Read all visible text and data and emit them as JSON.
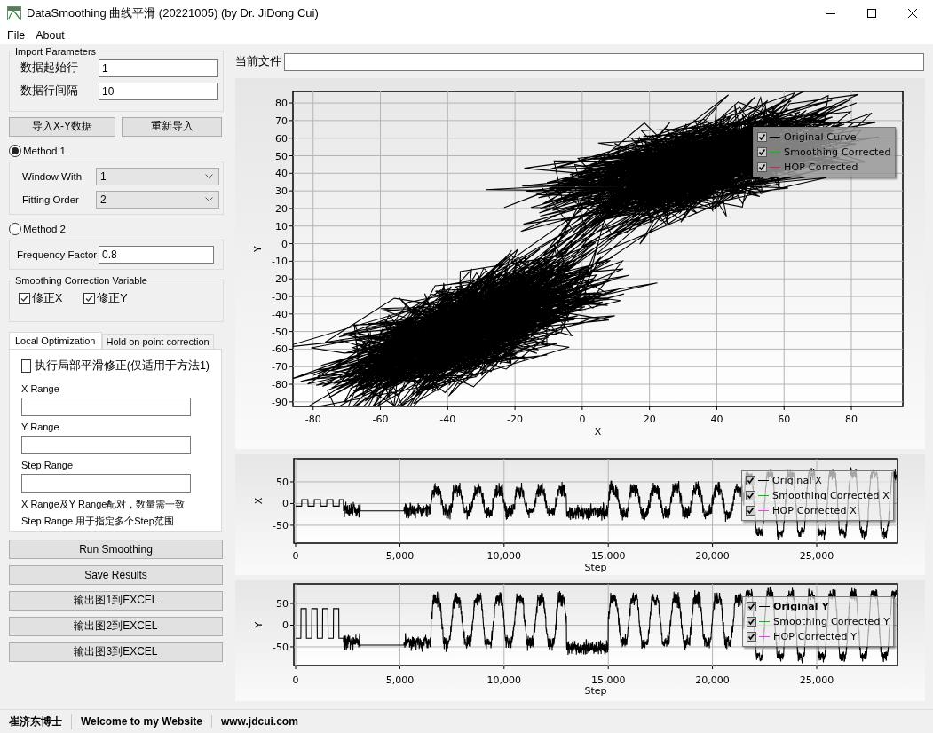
{
  "window": {
    "title": "DataSmoothing 曲线平滑 (20221005) (by Dr. JiDong Cui)"
  },
  "menu": [
    "File",
    "About"
  ],
  "import_parameters": {
    "title": "Import Parameters",
    "fields": [
      {
        "label": "数据起始行",
        "value": "1"
      },
      {
        "label": "数据行间隔",
        "value": "10"
      }
    ]
  },
  "import_buttons": [
    "导入X-Y数据",
    "重新导入"
  ],
  "methods": [
    {
      "label": "Method 1",
      "selected": true,
      "fields": [
        {
          "label": "Window With",
          "kind": "dropdown",
          "value": "1"
        },
        {
          "label": "Fitting Order",
          "kind": "dropdown",
          "value": "2"
        }
      ]
    },
    {
      "label": "Method 2",
      "selected": false,
      "fields": [
        {
          "label": "Frequency Factor",
          "kind": "text",
          "value": "0.8"
        }
      ]
    }
  ],
  "correction_variable": {
    "title": "Smoothing Correction Variable",
    "options": [
      {
        "label": "修正X",
        "checked": true
      },
      {
        "label": "修正Y",
        "checked": true
      }
    ]
  },
  "tabs": [
    {
      "label": "Local Optimization",
      "selected": true
    },
    {
      "label": "Hold on point correction",
      "selected": false
    }
  ],
  "local_optimization": {
    "checkbox": {
      "label": "执行局部平滑修正(仅适用于方法1)",
      "checked": false
    },
    "fields": [
      {
        "label": "X Range"
      },
      {
        "label": "Y Range"
      },
      {
        "label": "Step Range"
      }
    ],
    "notes": [
      "X Range及Y Range配对，数量需一致",
      "Step Range 用于指定多个Step范围"
    ]
  },
  "action_buttons": [
    "Run Smoothing",
    "Save Results",
    "输出图1到EXCEL",
    "输出图2到EXCEL",
    "输出图3到EXCEL"
  ],
  "current_file": {
    "label": "当前文件"
  },
  "charts": [
    {
      "kind": "trajectory",
      "xlabel": "X",
      "ylabel": "Y",
      "xticks": [
        "-80",
        "-60",
        "-40",
        "-20",
        "0",
        "20",
        "40",
        "60",
        "80"
      ],
      "yticks": [
        "80",
        "70",
        "60",
        "50",
        "40",
        "30",
        "20",
        "10",
        "0",
        "-10",
        "-20",
        "-30",
        "-40",
        "-50",
        "-60",
        "-70",
        "-80",
        "-90"
      ],
      "legend": [
        {
          "label": "Original Curve",
          "checked": true,
          "color": "#000000",
          "bold": false
        },
        {
          "label": "Smoothing Corrected",
          "checked": true,
          "color": "#00c000",
          "bold": false
        },
        {
          "label": "HOP Corrected",
          "checked": true,
          "color": "#d0206a",
          "bold": false
        }
      ]
    },
    {
      "kind": "xseries",
      "xlabel": "Step",
      "ylabel": "X",
      "xticks": [
        "0",
        "5,000",
        "10,000",
        "15,000",
        "20,000",
        "25,000"
      ],
      "yticks": [
        "50",
        "0",
        "-50"
      ],
      "legend": [
        {
          "label": "Original X",
          "checked": true,
          "color": "#000000",
          "bold": false
        },
        {
          "label": "Smoothing Corrected X",
          "checked": true,
          "color": "#00c000",
          "bold": false
        },
        {
          "label": "HOP Corrected X",
          "checked": true,
          "color": "#ff33ff",
          "bold": false
        }
      ]
    },
    {
      "kind": "yseries",
      "xlabel": "Step",
      "ylabel": "Y",
      "xticks": [
        "0",
        "5,000",
        "10,000",
        "15,000",
        "20,000",
        "25,000"
      ],
      "yticks": [
        "50",
        "0",
        "-50"
      ],
      "legend": [
        {
          "label": "Original Y",
          "checked": true,
          "color": "#000000",
          "bold": true
        },
        {
          "label": "Smoothing Corrected Y",
          "checked": true,
          "color": "#00c000",
          "bold": false
        },
        {
          "label": "HOP Corrected Y",
          "checked": true,
          "color": "#ff33ff",
          "bold": false
        }
      ]
    }
  ],
  "status_bar": [
    "崔济东博士",
    "Welcome to my Website",
    "www.jdcui.com"
  ]
}
